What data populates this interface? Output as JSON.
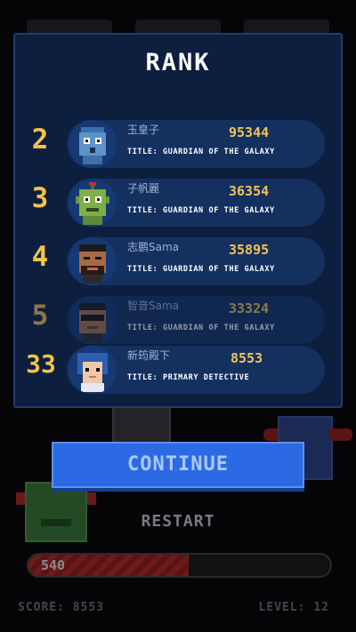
{
  "rank_panel": {
    "title": "RANK",
    "rows": [
      {
        "rank": "2",
        "name": "玉皇子",
        "score": "95344",
        "title": "TITLE: GUARDIAN OF THE GALAXY",
        "avatar": "blue-robot-avatar"
      },
      {
        "rank": "3",
        "name": "子帆麗",
        "score": "36354",
        "title": "TITLE: GUARDIAN OF THE GALAXY",
        "avatar": "green-alien-avatar"
      },
      {
        "rank": "4",
        "name": "志鹏Sama",
        "score": "35895",
        "title": "TITLE: GUARDIAN OF THE GALAXY",
        "avatar": "bearded-man-avatar"
      },
      {
        "rank": "5",
        "name": "智音Sama",
        "score": "33324",
        "title": "TITLE: GUARDIAN OF THE GALAXY",
        "avatar": "sunglasses-man-avatar"
      }
    ],
    "current_player": {
      "rank": "33",
      "name": "新筠殿下",
      "score": "8553",
      "title": "TITLE: PRIMARY DETECTIVE",
      "avatar": "blue-hair-boy-avatar"
    }
  },
  "actions": {
    "continue_label": "CONTINUE",
    "restart_label": "RESTART"
  },
  "hud": {
    "progress_value": "540",
    "progress_fraction": 0.53,
    "score_text": "SCORE: 8553",
    "level_text": "LEVEL: 12"
  },
  "colors": {
    "panel_bg": "#0d1f3f",
    "rank_gold": "#f2c24a",
    "continue_blue": "#2b6ae3",
    "progress_red": "#6e1a1a"
  }
}
